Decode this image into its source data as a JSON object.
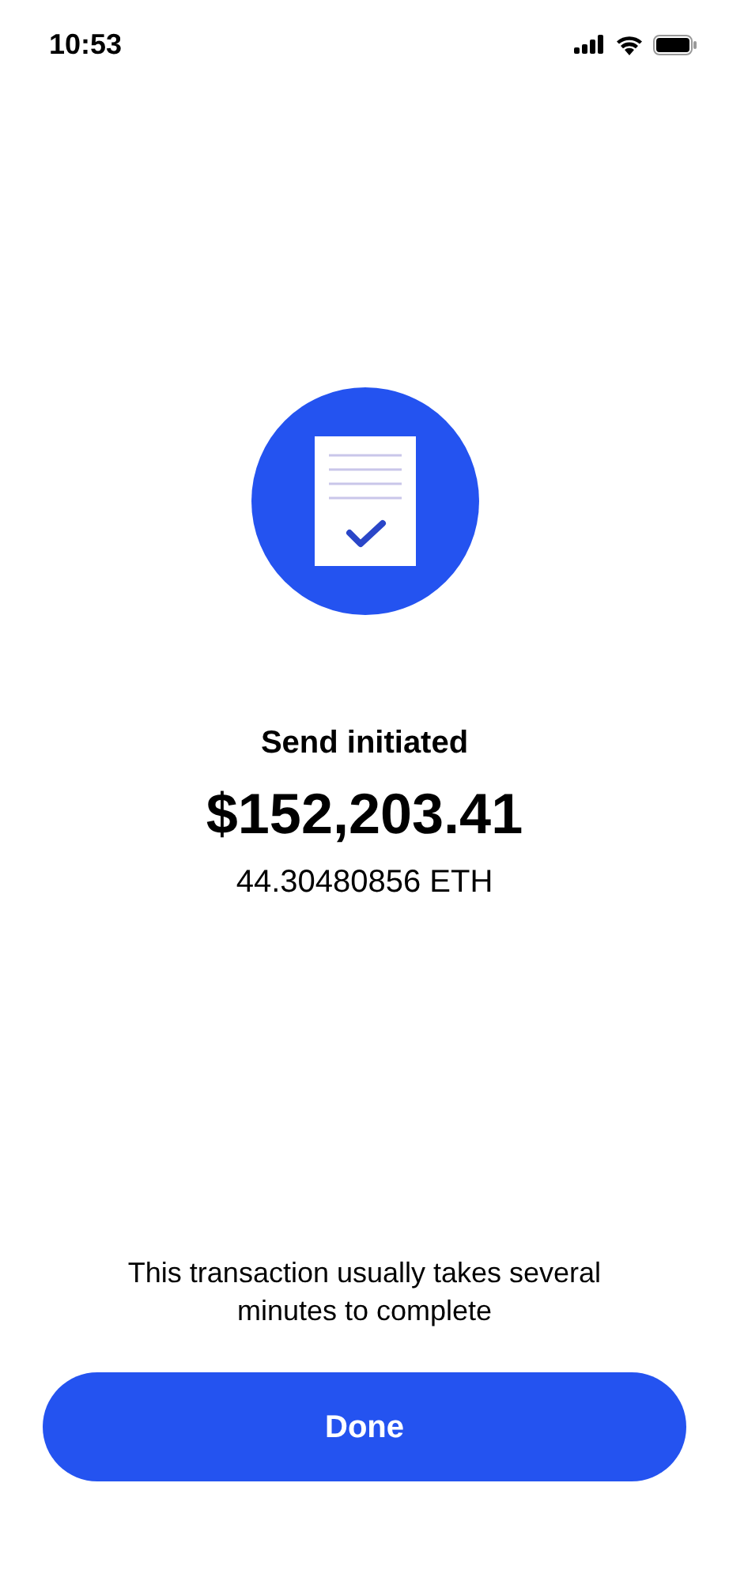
{
  "status_bar": {
    "time": "10:53"
  },
  "title": "Send initiated",
  "amount": "$152,203.41",
  "crypto_amount": "44.30480856 ETH",
  "message": "This transaction usually takes several minutes to complete",
  "button": "Done"
}
